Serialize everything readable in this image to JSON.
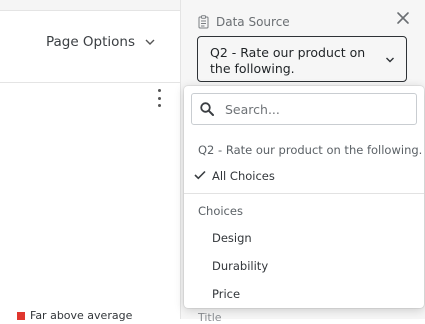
{
  "left": {
    "page_options_label": "Page Options",
    "legend": {
      "label": "Far above average",
      "color": "#e0362e"
    }
  },
  "right": {
    "data_source_label": "Data Source",
    "selected_source": "Q2 - Rate our product on the following.",
    "title_label": "Title"
  },
  "dropdown": {
    "search_placeholder": "Search...",
    "question_label": "Q2 - Rate our product on the following.",
    "all_choices_label": "All Choices",
    "choices_header": "Choices",
    "choices": [
      "Design",
      "Durability",
      "Price"
    ]
  },
  "icons": {
    "chevron": "chevron-down-icon",
    "close": "close-icon",
    "clipboard": "clipboard-icon",
    "search": "search-icon",
    "check": "check-icon",
    "kebab": "kebab-menu-icon"
  }
}
